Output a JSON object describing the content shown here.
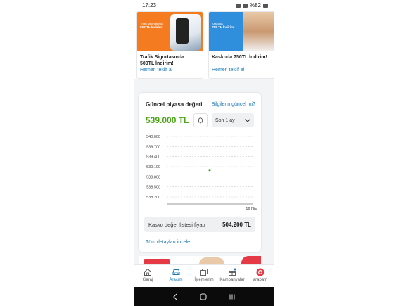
{
  "status_bar": {
    "time": "17:23",
    "battery": "%82"
  },
  "promos": [
    {
      "banner_text": "Trafik sigortasında",
      "banner_offer": "500 TL İndirim!",
      "title": "Trafik Sigortasında 500TL İndirim!",
      "link": "Hemen teklif al"
    },
    {
      "banner_text": "Kaskoda",
      "banner_offer": "750 TL İndirim!",
      "title": "Kaskoda 750TL İndirim!",
      "link": "Hemen teklif al"
    }
  ],
  "market": {
    "title": "Güncel piyasa değeri",
    "update_link": "Bilgilerin güncel mi?",
    "price": "539.000 TL",
    "period": "Son 1 ay",
    "kasko_label": "Kasko değer listesi fiyatı",
    "kasko_value": "504.200 TL",
    "details_link": "Tüm detayları incele"
  },
  "chart_data": {
    "type": "scatter",
    "y_ticks": [
      "540.000",
      "539.700",
      "539.400",
      "539.100",
      "538.800",
      "538.500",
      "538.200"
    ],
    "x_ticks": [
      "16 Nis"
    ],
    "ylim": [
      538200,
      540000
    ],
    "series": [
      {
        "x": [
          "16 Nis"
        ],
        "y": [
          539000
        ]
      }
    ],
    "grid": true,
    "colors": {
      "point": "#4aa616",
      "grid": "#cccccc"
    }
  },
  "bottom_nav": [
    {
      "label": "Garaj",
      "icon": "home-icon",
      "active": false
    },
    {
      "label": "Aracım",
      "icon": "car-icon",
      "active": true
    },
    {
      "label": "İşlemlerim",
      "icon": "documents-icon",
      "active": false
    },
    {
      "label": "Kampanyalar",
      "icon": "gift-icon",
      "active": false
    },
    {
      "label": "arabam",
      "icon": "arabam-logo-icon",
      "active": false
    }
  ],
  "colors": {
    "accent": "#1a7ab8",
    "price": "#4aa616",
    "brand_red": "#e63946",
    "promo_orange": "#f47b20",
    "promo_blue": "#2f8fdc"
  }
}
